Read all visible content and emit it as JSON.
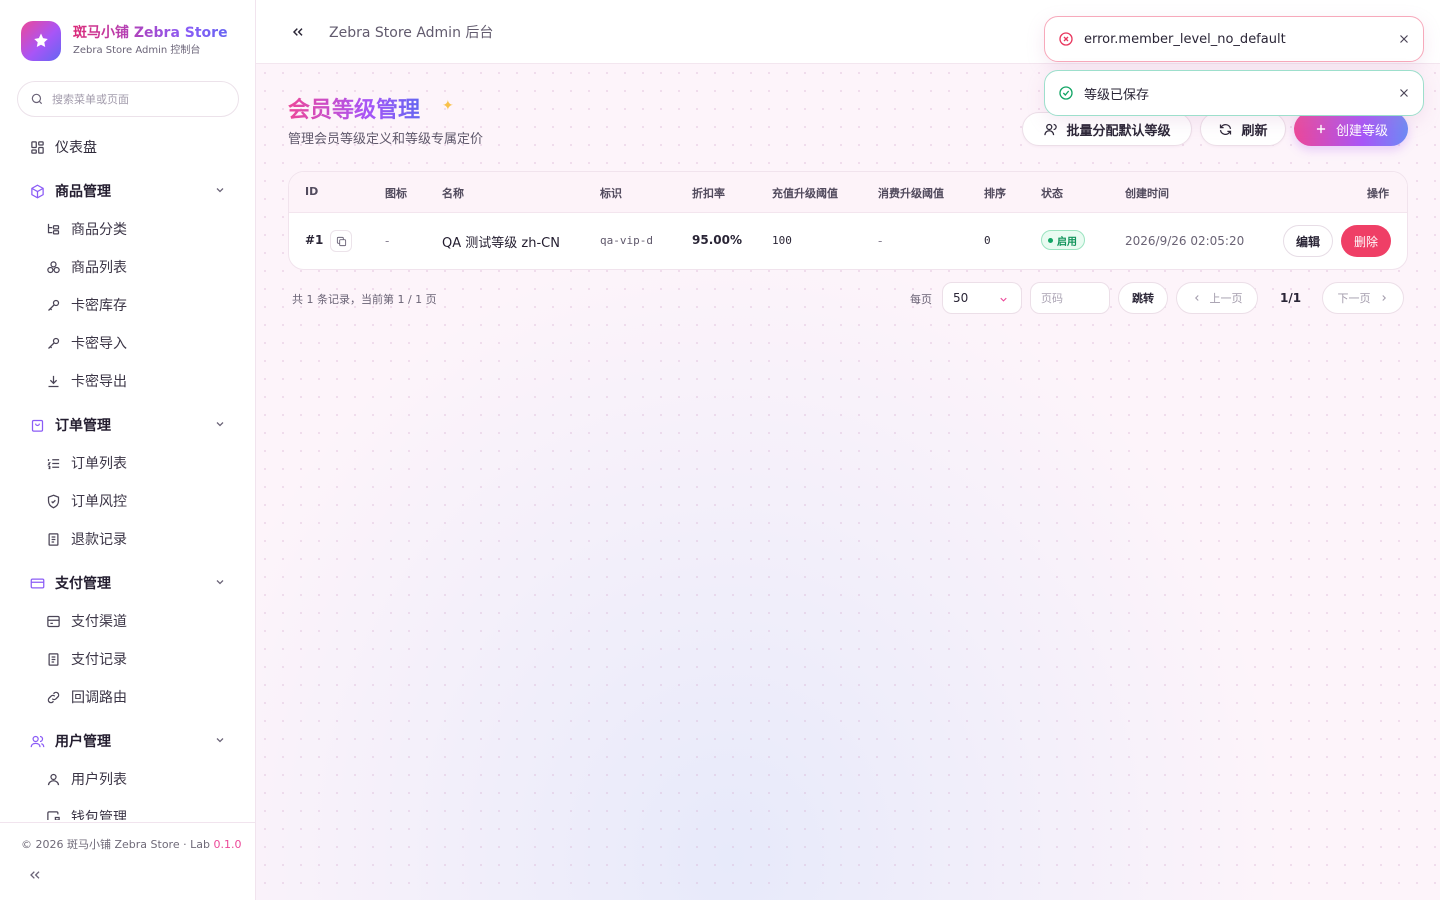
{
  "brand": {
    "title": "斑马小铺 Zebra Store",
    "subtitle": "Zebra Store Admin 控制台"
  },
  "search": {
    "placeholder": "搜索菜单或页面"
  },
  "sidebar": {
    "dashboard": "仪表盘",
    "groups": [
      {
        "label": "商品管理",
        "items": [
          "商品分类",
          "商品列表",
          "卡密库存",
          "卡密导入",
          "卡密导出"
        ]
      },
      {
        "label": "订单管理",
        "items": [
          "订单列表",
          "订单风控",
          "退款记录"
        ]
      },
      {
        "label": "支付管理",
        "items": [
          "支付渠道",
          "支付记录",
          "回调路由"
        ]
      },
      {
        "label": "用户管理",
        "items": [
          "用户列表",
          "钱包管理"
        ]
      }
    ],
    "footer": {
      "copyright": "© 2026 斑马小铺 Zebra Store · Lab",
      "version": "0.1.0"
    }
  },
  "header": {
    "breadcrumb": "Zebra Store Admin 后台"
  },
  "page": {
    "title": "会员等级管理",
    "subtitle": "管理会员等级定义和等级专属定价",
    "actions": {
      "assign_default": "批量分配默认等级",
      "refresh": "刷新",
      "create": "创建等级"
    }
  },
  "table": {
    "columns": [
      "ID",
      "图标",
      "名称",
      "标识",
      "折扣率",
      "充值升级阈值",
      "消费升级阈值",
      "排序",
      "状态",
      "创建时间",
      "操作"
    ],
    "rows": [
      {
        "id": "#1",
        "icon": "-",
        "name": "QA 测试等级 zh-CN",
        "slug": "qa-vip-d",
        "discount": "95.00%",
        "recharge_threshold": "100",
        "spend_threshold": "-",
        "sort": "0",
        "status": "启用",
        "created_at": "2026/9/26 02:05:20",
        "edit_label": "编辑",
        "delete_label": "删除"
      }
    ]
  },
  "pagination": {
    "summary": "共 1 条记录，当前第 1 / 1 页",
    "per_page_label": "每页",
    "per_page_value": "50",
    "page_input_placeholder": "页码",
    "jump_label": "跳转",
    "prev_label": "上一页",
    "current": "1/1",
    "next_label": "下一页"
  },
  "toasts": [
    {
      "type": "error",
      "message": "error.member_level_no_default"
    },
    {
      "type": "success",
      "message": "等级已保存"
    }
  ],
  "colors": {
    "accent_pink": "#ec4899",
    "accent_purple": "#a855f7",
    "accent_indigo": "#6366f1",
    "danger": "#ef3f66",
    "success": "#11935a"
  }
}
